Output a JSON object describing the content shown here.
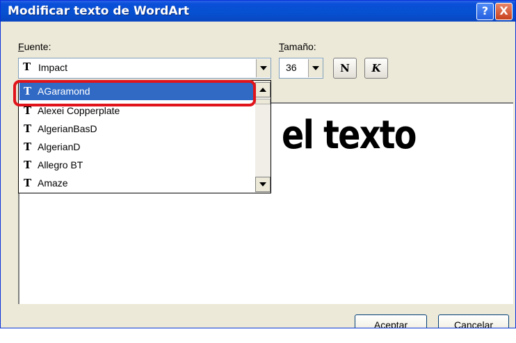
{
  "window": {
    "title": "Modificar texto de WordArt"
  },
  "titlebar": {
    "help_label": "?",
    "close_label": "X"
  },
  "font": {
    "label": "Fuente:",
    "label_underline": "F",
    "label_rest": "uente:",
    "selected": "Impact",
    "options": [
      "AGaramond",
      "Alexei Copperplate",
      "AlgerianBasD",
      "AlgerianD",
      "Allegro BT",
      "Amaze"
    ],
    "highlighted": "AGaramond"
  },
  "size": {
    "label_underline": "T",
    "label_rest": "amaño:",
    "value": "36"
  },
  "style": {
    "bold_label": "N",
    "italic_label": "K"
  },
  "preview": {
    "text": "el texto"
  },
  "buttons": {
    "ok": "Aceptar",
    "cancel": "Cancelar"
  },
  "icons": {
    "font_type": "truetype-font-icon"
  },
  "colors": {
    "title_bar": "#0a4fd8",
    "selection": "#316ac5",
    "highlight": "#e0141a"
  }
}
